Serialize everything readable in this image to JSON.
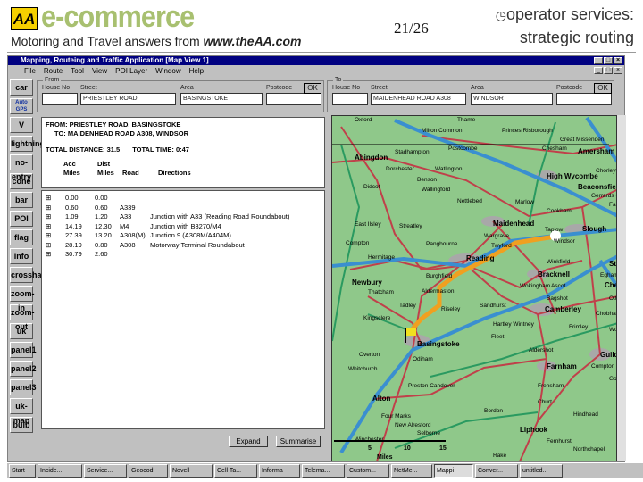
{
  "slide": {
    "logo_text": "AA",
    "brand": "e-commerce",
    "tagline_prefix": "Motoring and Travel answers from ",
    "tagline_url": "www.theAA.com",
    "page_number": "21/26",
    "title_line1": "operator services:",
    "title_line2": "strategic routing",
    "bullet_icon": "clock-icon"
  },
  "window": {
    "title": "Mapping, Routeing and Traffic Application   [Map View 1]",
    "menu": [
      "File",
      "Route",
      "Tool",
      "View",
      "POI Layer",
      "Window",
      "Help"
    ]
  },
  "from": {
    "label": "From",
    "house_label": "House No",
    "street_label": "Street",
    "area_label": "Area",
    "postcode_label": "Postcode",
    "house": "",
    "street": "PRIESTLEY ROAD",
    "area": "BASINGSTOKE",
    "postcode": "",
    "ok": "OK"
  },
  "to": {
    "label": "To",
    "house_label": "House No",
    "street_label": "Street",
    "area_label": "Area",
    "postcode_label": "Postcode",
    "house": "",
    "street": "MAIDENHEAD ROAD A308",
    "area": "WINDSOR",
    "postcode": "",
    "ok": "OK"
  },
  "toolbar": [
    "car",
    "Auto GPS",
    "V",
    "lightning",
    "no-entry",
    "cone",
    "bar",
    "POI",
    "flag",
    "info",
    "crosshair",
    "zoom-in",
    "zoom-out",
    "uk",
    "panel1",
    "panel2",
    "panel3",
    "uk-map",
    "bulb"
  ],
  "directions": {
    "from_line": "FROM:  PRIESTLEY ROAD,  BASINGSTOKE",
    "to_line": "TO:  MAIDENHEAD ROAD A308,  WINDSOR",
    "total_distance": "TOTAL DISTANCE: 31.5",
    "total_time": "TOTAL TIME: 0:47",
    "col_acc": [
      "Acc",
      "Miles"
    ],
    "col_dist": [
      "Dist",
      "Miles"
    ],
    "col_road": "Road",
    "col_dir": "Directions",
    "rows": [
      {
        "acc": "0.00",
        "dist": "0.00",
        "road": "",
        "dir": ""
      },
      {
        "acc": "0.60",
        "dist": "0.60",
        "road": "A339",
        "dir": ""
      },
      {
        "acc": "1.09",
        "dist": "1.20",
        "road": "A33",
        "dir": "Junction with A33 (Reading Road Roundabout)"
      },
      {
        "acc": "14.19",
        "dist": "12.30",
        "road": "M4",
        "dir": "Junction with B3270/M4"
      },
      {
        "acc": "27.39",
        "dist": "13.20",
        "road": "A308(M)",
        "dir": "Junction 9 (A308M/A404M)"
      },
      {
        "acc": "28.19",
        "dist": "0.80",
        "road": "A308",
        "dir": "Motorway Terminal Roundabout"
      },
      {
        "acc": "30.79",
        "dist": "2.60",
        "road": "",
        "dir": ""
      }
    ],
    "expand": "Expand",
    "summarise": "Summarise"
  },
  "map": {
    "places": [
      "Oxford",
      "Thame",
      "Milton Common",
      "Princes Risborough",
      "Great Missenden",
      "Chesham",
      "Amersham",
      "Stadhampton",
      "Postcombe",
      "Abingdon",
      "Dorchester",
      "Watlington",
      "High Wycombe",
      "Chorleywood",
      "Benson",
      "Wallingford",
      "Beaconsfield",
      "Didcot",
      "Gerrards Cross",
      "Nettlebed",
      "Marlow",
      "Farnham Common",
      "East Ilsley",
      "Cookham",
      "Streatley",
      "Maidenhead",
      "Taplow",
      "Slough",
      "Wargrave",
      "Windsor",
      "Twyford",
      "Compton",
      "Pangbourne",
      "Reading",
      "Hermitage",
      "Winkfield",
      "Staines",
      "Burghfield",
      "Bracknell",
      "Newbury",
      "Egham",
      "Thatcham",
      "Aldermaston",
      "Wokingham",
      "Ascot",
      "Chertsey",
      "Tadley",
      "Riseley",
      "Sandhurst",
      "Bagshot",
      "Camberley",
      "Ottershaw",
      "Chobham",
      "Kingsclere",
      "Hartley Wintney",
      "Fleet",
      "Basingstoke",
      "Frimley",
      "Woking",
      "Overton",
      "Odiham",
      "Aldershot",
      "Guildford",
      "Whitchurch",
      "Farnham",
      "Compton",
      "Preston Candover",
      "Frensham",
      "Godalming",
      "Alton",
      "Churt",
      "Four Marks",
      "Bordon",
      "Hindhead",
      "New Alresford",
      "Liphook",
      "Selborne",
      "Winchester",
      "Fernhurst",
      "Northchapel",
      "Rake"
    ],
    "scale_ticks": [
      "5",
      "10",
      "15"
    ],
    "scale_unit": "Miles",
    "colors": {
      "land": "#8fc88a",
      "motorway": "#3a8fd0",
      "aroad": "#c0404a",
      "primary": "#2a9a60",
      "route": "#f0a020"
    }
  },
  "taskbar": [
    "Start",
    "Incide...",
    "Service...",
    "Geocod",
    "Novell",
    "Cell Ta...",
    "Informa",
    "Telema...",
    "Custom...",
    "NetMe...",
    "Mappi",
    "Conver...",
    "untitled..."
  ]
}
